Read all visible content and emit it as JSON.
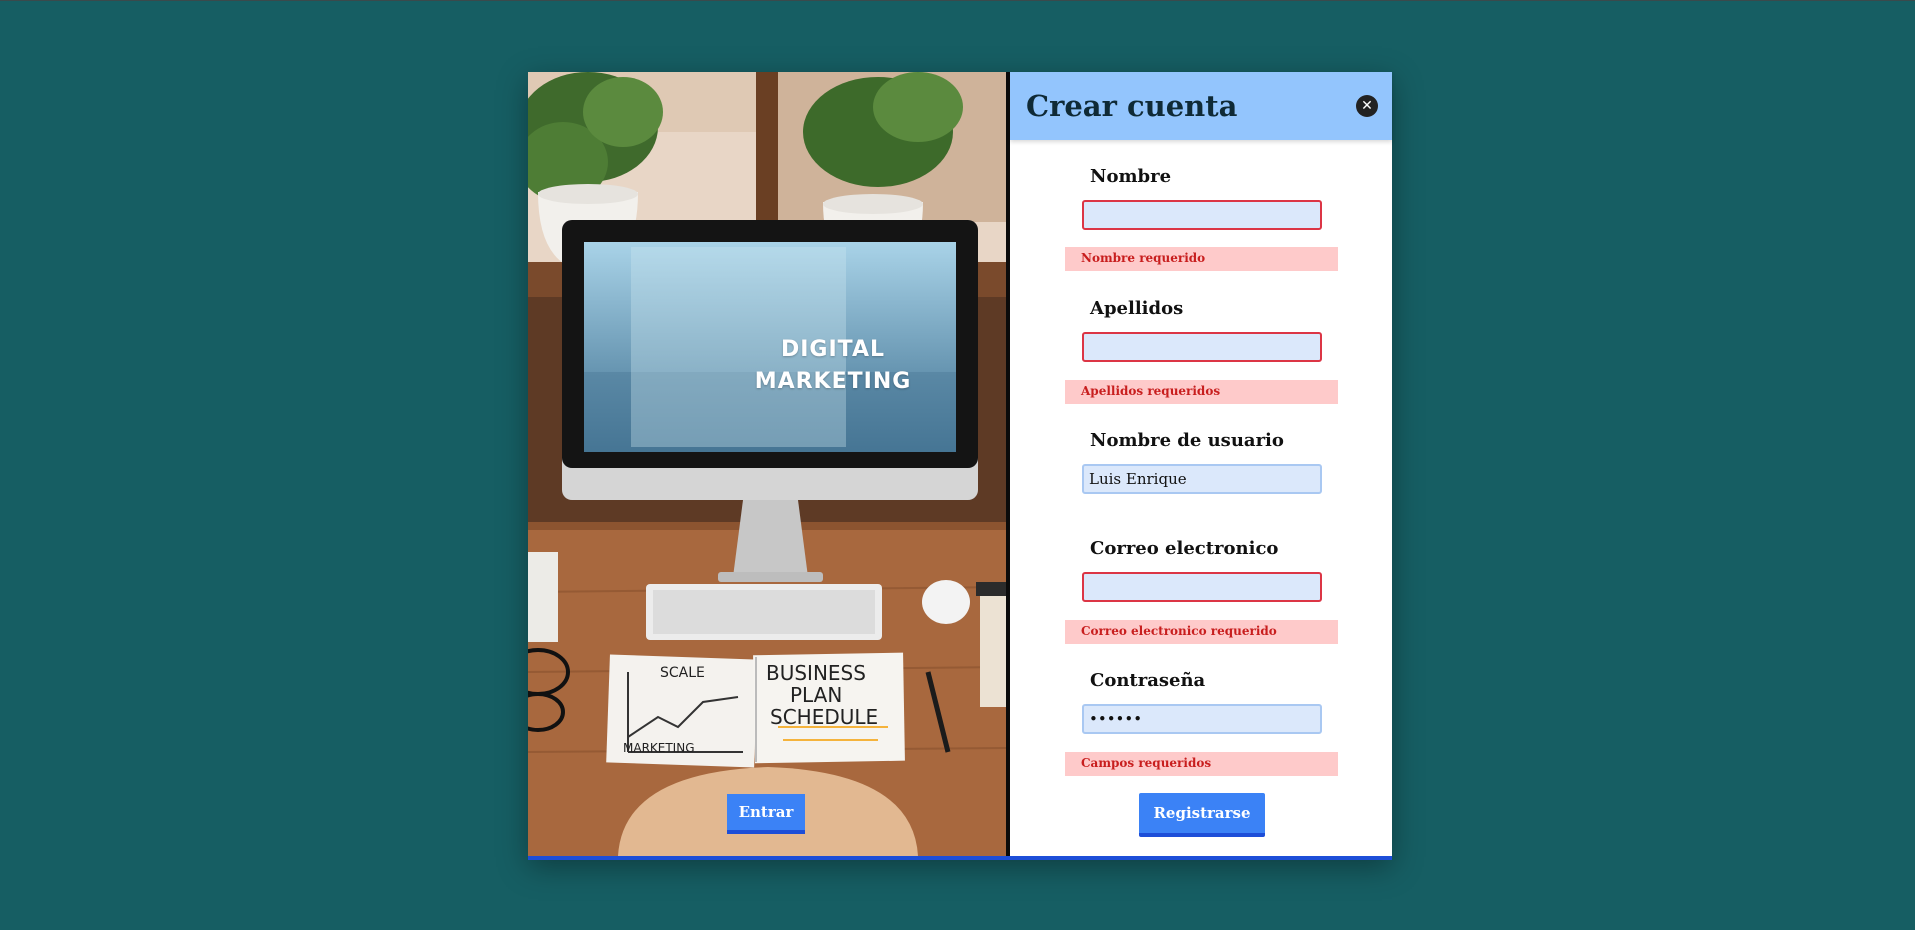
{
  "page": {
    "background": "#165e63"
  },
  "image_panel": {
    "monitor_text_line1": "DIGITAL",
    "monitor_text_line2": "MARKETING",
    "notebook_left_top": "SCALE",
    "notebook_left_bottom": "MARKETING",
    "notebook_right_1": "BUSINESS",
    "notebook_right_2": "PLAN",
    "notebook_right_3": "SCHEDULE"
  },
  "login_button": {
    "label": "Entrar"
  },
  "form": {
    "title": "Crear cuenta",
    "close_icon": "close-icon",
    "fields": [
      {
        "label": "Nombre",
        "value": "",
        "error": "Nombre requerido"
      },
      {
        "label": "Apellidos",
        "value": "",
        "error": "Apellidos requeridos"
      },
      {
        "label": "Nombre de usuario",
        "value": "Luis Enrique",
        "error": ""
      },
      {
        "label": "Correo electronico",
        "value": "",
        "error": "Correo electronico requerido"
      },
      {
        "label": "Contraseña",
        "value": "••••••",
        "error": "Campos requeridos"
      }
    ],
    "submit_label": "Registrarse"
  },
  "colors": {
    "header": "#93c5fd",
    "button": "#3b82f6",
    "button_border": "#1d4ed8",
    "error_bg": "#fecaca",
    "error_text": "#c81e1e",
    "input_bg": "#dbe8fb"
  }
}
